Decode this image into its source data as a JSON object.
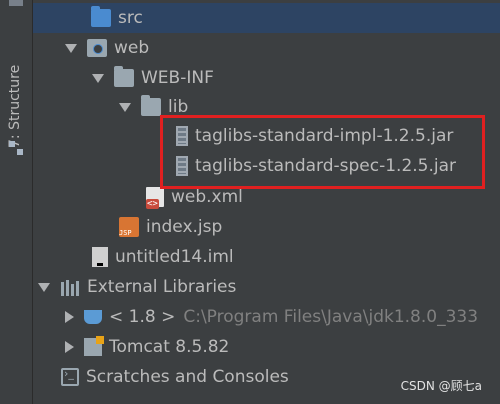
{
  "sidebar": {
    "structure_tab_label": "7: Structure"
  },
  "tree": {
    "src": "src",
    "web": "web",
    "web_inf": "WEB-INF",
    "lib": "lib",
    "jar_impl": "taglibs-standard-impl-1.2.5.jar",
    "jar_spec": "taglibs-standard-spec-1.2.5.jar",
    "web_xml": "web.xml",
    "index_jsp": "index.jsp",
    "iml": "untitled14.iml",
    "external_libraries": "External Libraries",
    "jdk": "< 1.8 >",
    "jdk_path": "C:\\Program Files\\Java\\jdk1.8.0_333",
    "tomcat": "Tomcat 8.5.82",
    "scratches": "Scratches and Consoles"
  },
  "watermark": "CSDN @顾七a",
  "colors": {
    "background": "#3c3f41",
    "selection": "#2d4463",
    "highlight_box": "#e02020"
  }
}
